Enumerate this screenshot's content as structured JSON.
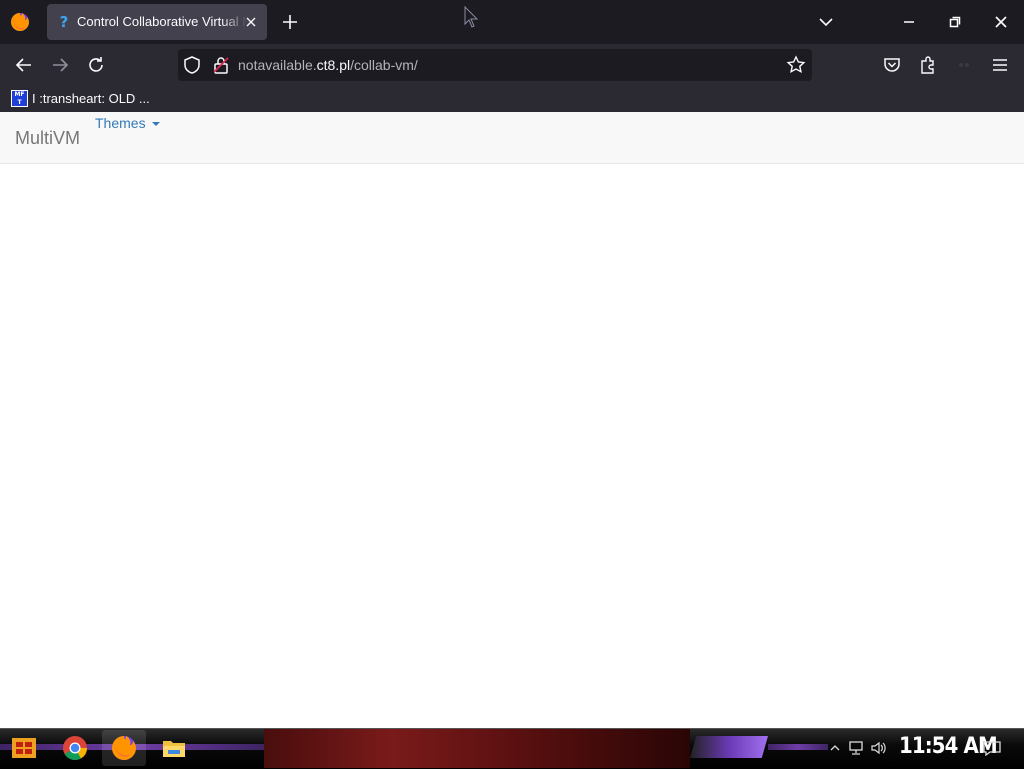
{
  "browser": {
    "tab": {
      "title": "Control Collaborative Virtual Machines",
      "favicon": "question-mark-icon"
    },
    "url": {
      "prefix": "notavailable.",
      "domain": "ct8.pl",
      "path": "/collab-vm/"
    },
    "bookmarks": [
      {
        "icon_text": "MF T",
        "label": "I :transheart: OLD ..."
      }
    ]
  },
  "page": {
    "brand": "MultiVM",
    "menu": {
      "themes_label": "Themes"
    }
  },
  "taskbar": {
    "apps": [
      "start-icon",
      "chrome-icon",
      "firefox-icon",
      "file-explorer-icon"
    ],
    "clock": "11:54 AM"
  },
  "colors": {
    "titlebar": "#1c1b22",
    "navbar": "#2b2a33",
    "link": "#337ab7",
    "brand_text": "#777777"
  }
}
